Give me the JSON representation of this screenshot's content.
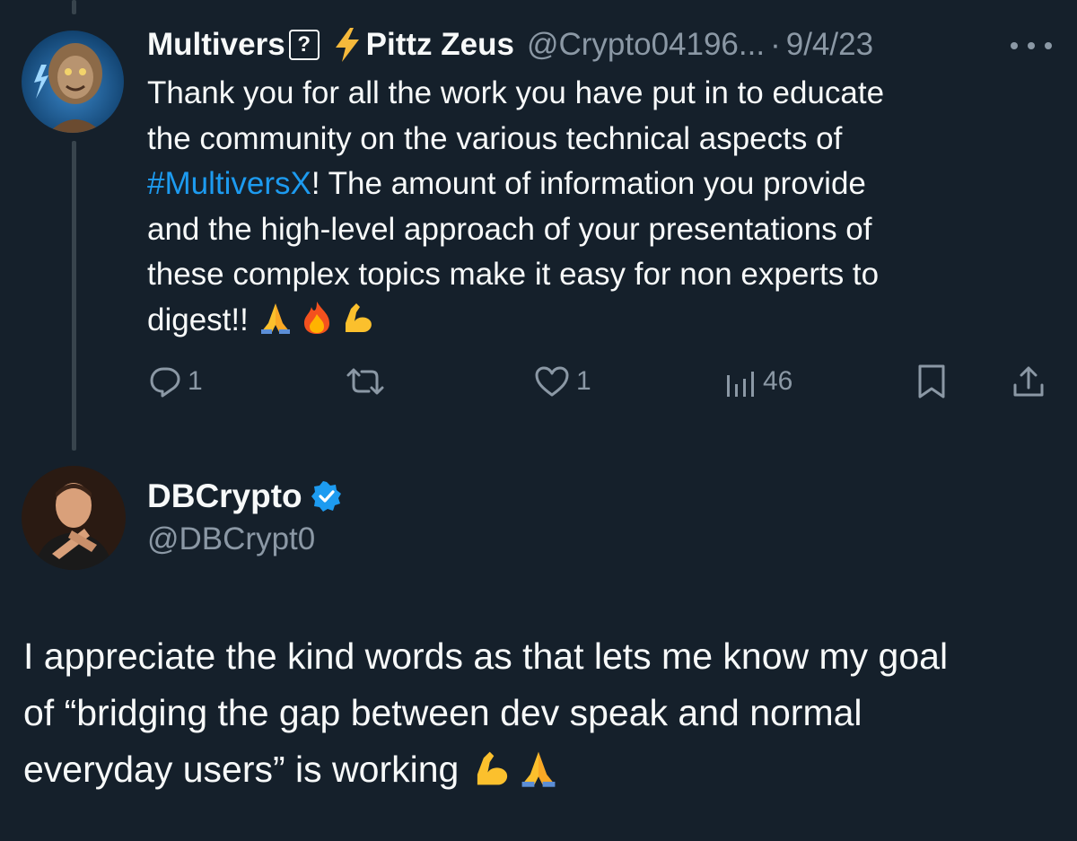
{
  "reply_tweet": {
    "display_name_part1": "Multivers",
    "unknown_glyph": "?",
    "display_name_part2": "Pittz Zeus",
    "handle": "@Crypto04196...",
    "separator": "·",
    "date": "9/4/23",
    "body_lines": [
      "Thank you for all the work you have put in to educate",
      "the community on the various technical aspects of",
      "The amount of information you provide",
      "and the high-level approach of your presentations of",
      "these complex topics make it easy for non experts to",
      "digest!!"
    ],
    "hashtag": "#MultiversX",
    "hashtag_suffix": "!",
    "emojis": [
      "folded-hands-emoji",
      "fire-emoji",
      "flexed-biceps-emoji"
    ],
    "actions": {
      "reply_count": "1",
      "retweet_count": "",
      "like_count": "1",
      "views_count": "46"
    }
  },
  "original_tweet": {
    "display_name": "DBCrypto",
    "verified": true,
    "handle": "@DBCrypt0",
    "body_lines": [
      "I appreciate the kind words as that lets me know my goal",
      "of “bridging the gap between dev speak and normal",
      "everyday users” is working"
    ],
    "emojis": [
      "flexed-biceps-emoji",
      "folded-hands-emoji"
    ]
  },
  "colors": {
    "background": "#15202b",
    "text_primary": "#f7f9f9",
    "text_secondary": "#8b98a5",
    "link": "#1d9bf0",
    "verified": "#1d9bf0",
    "thread_line": "#38444d"
  },
  "icons": {
    "more": "more-horizontal-icon",
    "reply": "reply-icon",
    "retweet": "retweet-icon",
    "like": "heart-icon",
    "views": "views-bar-chart-icon",
    "bookmark": "bookmark-icon",
    "share": "share-icon"
  }
}
